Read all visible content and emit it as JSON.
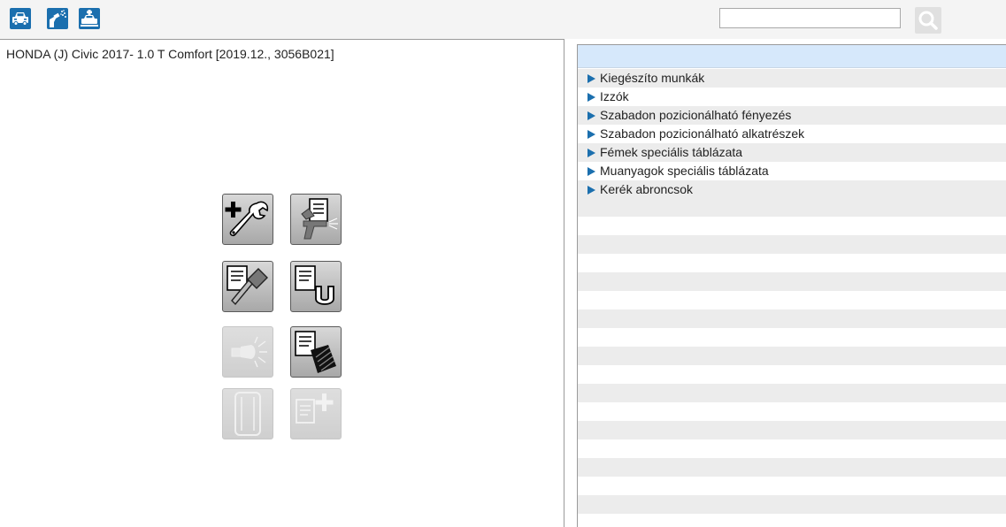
{
  "toolbar": {
    "icons": [
      "vehicle-icon",
      "paint-spray-icon",
      "vehicle-repair-icon"
    ],
    "search": {
      "value": "",
      "placeholder": ""
    },
    "search_button_icon": "magnifier-icon"
  },
  "left_panel": {
    "vehicle_title": "HONDA (J) Civic 2017- 1.0 T Comfort [2019.12., 3056B021]",
    "tools": [
      {
        "name": "additional-work-icon",
        "enabled": true
      },
      {
        "name": "paint-gun-document-icon",
        "enabled": true
      },
      {
        "name": "hammer-document-icon",
        "enabled": true
      },
      {
        "name": "magnet-document-icon",
        "enabled": true
      },
      {
        "name": "bulb-icon",
        "enabled": false
      },
      {
        "name": "tire-document-icon",
        "enabled": true
      },
      {
        "name": "tire-icon",
        "enabled": false
      },
      {
        "name": "add-document-icon",
        "enabled": false
      }
    ]
  },
  "right_panel": {
    "categories": [
      "Kiegészíto munkák",
      "Izzók",
      "Szabadon pozicionálható fényezés",
      "Szabadon pozicionálható alkatrészek",
      "Fémek speciális táblázata",
      "Muanyagok speciális táblázata",
      "Kerék abroncsok"
    ]
  },
  "colors": {
    "accent": "#1b6fae",
    "header_bg": "#d6e8fb",
    "stripe": "#ececec"
  }
}
